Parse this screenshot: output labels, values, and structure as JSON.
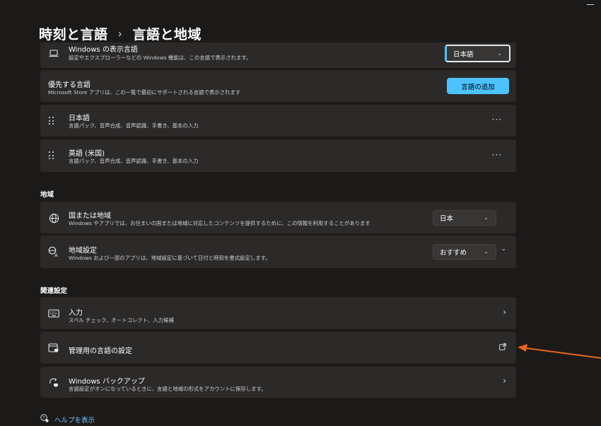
{
  "header": {
    "breadcrumb_parent": "時刻と言語",
    "page_title": "言語と地域"
  },
  "display_language": {
    "title": "Windows の表示言語",
    "desc": "設定やエクスプローラーなどの Windows 機能は、この言語で表示されます。",
    "selected": "日本語"
  },
  "preferred_languages": {
    "title": "優先する言語",
    "desc": "Microsoft Store アプリは、この一覧で最初にサポートされる言語で表示されます",
    "add_button": "言語の追加",
    "items": [
      {
        "name": "日本語",
        "features": "言語パック、音声合成、音声認識、手書き、基本の入力",
        "more": "···"
      },
      {
        "name": "英語 (米国)",
        "features": "言語パック、音声合成、音声認識、手書き、基本の入力",
        "more": "···"
      }
    ]
  },
  "region": {
    "section_title": "地域",
    "country": {
      "title": "国または地域",
      "desc": "Windows やアプリでは、お住まいの国または地域に対応したコンテンツを提供するために、この情報を利用することがあります",
      "selected": "日本"
    },
    "format": {
      "title": "地域設定",
      "desc": "Windows および一部のアプリは、地域設定に基づいて日付と時刻を書式設定します。",
      "selected": "おすすめ"
    }
  },
  "related": {
    "section_title": "関連設定",
    "typing": {
      "title": "入力",
      "desc": "スペル チェック、オートコレクト、入力候補"
    },
    "admin_language": {
      "title": "管理用の言語の設定"
    },
    "backup": {
      "title": "Windows バックアップ",
      "desc": "言語設定がオンになっているときに、言語と地域の形式をアカウントに保存します。"
    }
  },
  "help": {
    "label": "ヘルプを表示"
  },
  "colors": {
    "background": "#1c1a19",
    "card": "#2c2a29",
    "accent": "#4cc2ff",
    "annotation_arrow": "#e8651c"
  }
}
